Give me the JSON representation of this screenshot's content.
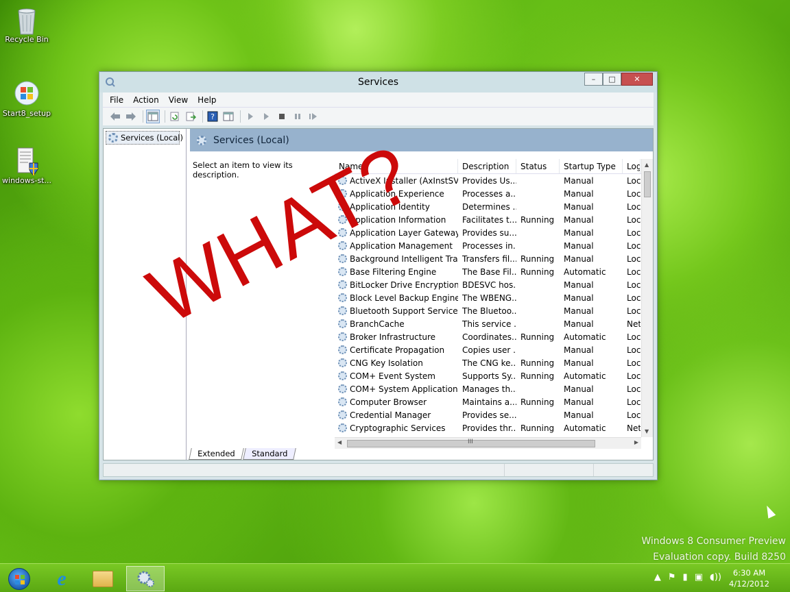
{
  "desktop": {
    "icons": [
      {
        "label": "Recycle Bin",
        "icon": "recycle-bin-icon"
      },
      {
        "label": "Start8_setup",
        "icon": "windows-setup-icon"
      },
      {
        "label": "windows-st...",
        "icon": "document-shield-icon"
      }
    ],
    "watermark": {
      "line1": "Windows 8 Consumer Preview",
      "line2": "Evaluation copy. Build 8250"
    },
    "overlay_text": "WHAT?"
  },
  "window": {
    "title": "Services",
    "controls": {
      "minimize": "–",
      "maximize": "□",
      "close": "✕"
    },
    "menu": [
      "File",
      "Action",
      "View",
      "Help"
    ],
    "tree": {
      "item": "Services (Local)"
    },
    "header": "Services (Local)",
    "description_prompt": "Select an item to view its description.",
    "columns": {
      "name": "Name",
      "description": "Description",
      "status": "Status",
      "startup": "Startup Type",
      "logon": "Log"
    },
    "services": [
      {
        "name": "ActiveX Installer (AxInstSV)",
        "description": "Provides Us...",
        "status": "",
        "startup": "Manual",
        "logon": "Loc"
      },
      {
        "name": "Application Experience",
        "description": "Processes a...",
        "status": "",
        "startup": "Manual",
        "logon": "Loc"
      },
      {
        "name": "Application Identity",
        "description": "Determines ...",
        "status": "",
        "startup": "Manual",
        "logon": "Loc"
      },
      {
        "name": "Application Information",
        "description": "Facilitates t...",
        "status": "Running",
        "startup": "Manual",
        "logon": "Loc"
      },
      {
        "name": "Application Layer Gateway ...",
        "description": "Provides su...",
        "status": "",
        "startup": "Manual",
        "logon": "Loc"
      },
      {
        "name": "Application Management",
        "description": "Processes in...",
        "status": "",
        "startup": "Manual",
        "logon": "Loc"
      },
      {
        "name": "Background Intelligent Tran...",
        "description": "Transfers fil...",
        "status": "Running",
        "startup": "Manual",
        "logon": "Loc"
      },
      {
        "name": "Base Filtering Engine",
        "description": "The Base Fil...",
        "status": "Running",
        "startup": "Automatic",
        "logon": "Loc"
      },
      {
        "name": "BitLocker Drive Encryption ...",
        "description": "BDESVC hos...",
        "status": "",
        "startup": "Manual",
        "logon": "Loc"
      },
      {
        "name": "Block Level Backup Engine ...",
        "description": "The WBENG...",
        "status": "",
        "startup": "Manual",
        "logon": "Loc"
      },
      {
        "name": "Bluetooth Support Service",
        "description": "The Bluetoo...",
        "status": "",
        "startup": "Manual",
        "logon": "Loc"
      },
      {
        "name": "BranchCache",
        "description": "This service ...",
        "status": "",
        "startup": "Manual",
        "logon": "Net"
      },
      {
        "name": "Broker Infrastructure",
        "description": "Coordinates...",
        "status": "Running",
        "startup": "Automatic",
        "logon": "Loc"
      },
      {
        "name": "Certificate Propagation",
        "description": "Copies user ...",
        "status": "",
        "startup": "Manual",
        "logon": "Loc"
      },
      {
        "name": "CNG Key Isolation",
        "description": "The CNG ke...",
        "status": "Running",
        "startup": "Manual",
        "logon": "Loc"
      },
      {
        "name": "COM+ Event System",
        "description": "Supports Sy...",
        "status": "Running",
        "startup": "Automatic",
        "logon": "Loc"
      },
      {
        "name": "COM+ System Application",
        "description": "Manages th...",
        "status": "",
        "startup": "Manual",
        "logon": "Loc"
      },
      {
        "name": "Computer Browser",
        "description": "Maintains a...",
        "status": "Running",
        "startup": "Manual",
        "logon": "Loc"
      },
      {
        "name": "Credential Manager",
        "description": "Provides se...",
        "status": "",
        "startup": "Manual",
        "logon": "Loc"
      },
      {
        "name": "Cryptographic Services",
        "description": "Provides thr...",
        "status": "Running",
        "startup": "Automatic",
        "logon": "Net"
      }
    ],
    "tabs": [
      "Extended",
      "Standard"
    ],
    "hscroll_grip": "III"
  },
  "taskbar": {
    "clock_time": "6:30 AM",
    "clock_date": "4/12/2012",
    "tray": {
      "show_hidden": "▲",
      "flag": "⚑",
      "power": "▮",
      "network": "▣",
      "volume": "◖))"
    }
  },
  "colors": {
    "accent": "#97b2cd",
    "overlay": "#cc0a0a",
    "close": "#c75050"
  }
}
